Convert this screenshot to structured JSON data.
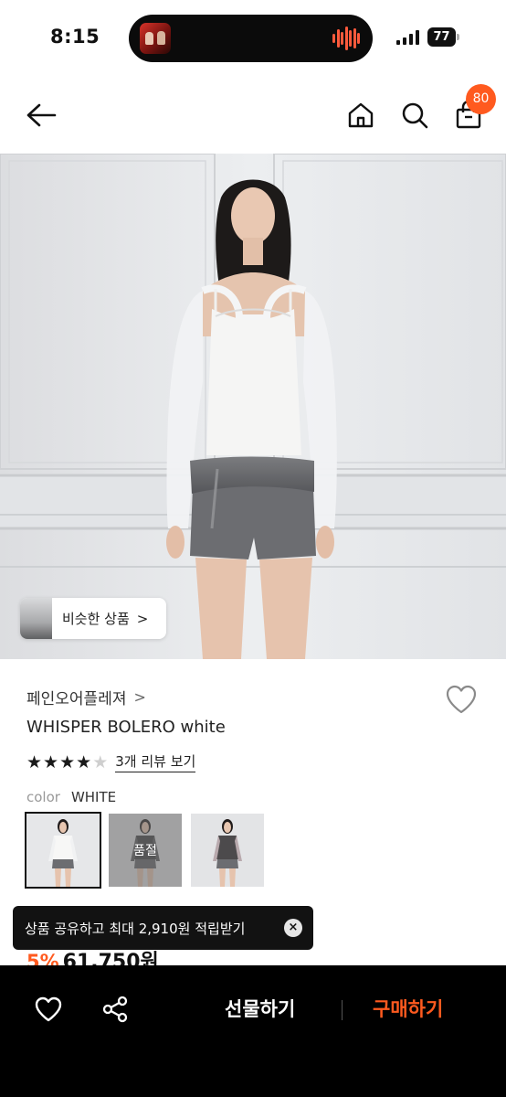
{
  "status_bar": {
    "time": "8:15",
    "battery": "77"
  },
  "header": {
    "cart_count": "80",
    "icons": [
      "back-arrow-icon",
      "home-icon",
      "search-icon",
      "shopping-bag-icon"
    ]
  },
  "hero": {
    "similar_label": "비슷한 상품",
    "similar_chevron": ">"
  },
  "product": {
    "brand": "페인오어플레져",
    "brand_chevron": ">",
    "title": "WHISPER BOLERO white",
    "rating_stars": 4,
    "rating_max": 5,
    "review_link": "3개 리뷰 보기",
    "color_label": "color",
    "color_value": "WHITE",
    "swatches": [
      {
        "selected": true
      },
      {
        "sold_out_label": "품절"
      },
      {}
    ],
    "discount": "5%",
    "price": "61,750원"
  },
  "toast": {
    "text": "상품 공유하고 최대 2,910원 적립받기",
    "close_symbol": "×"
  },
  "bottom_bar": {
    "gift_label": "선물하기",
    "buy_label": "구매하기"
  },
  "colors": {
    "accent": "#ff5a1f",
    "bottom_bar_bg": "#000000",
    "toast_bg": "#121212"
  }
}
